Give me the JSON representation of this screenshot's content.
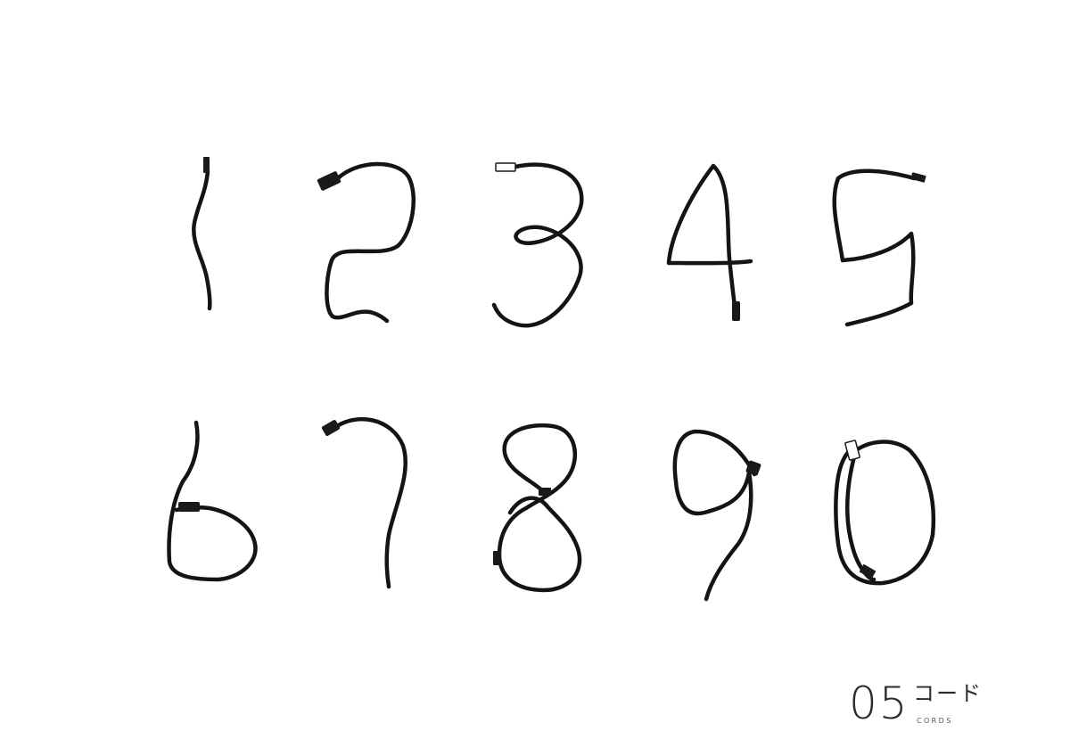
{
  "caption": {
    "number": "05",
    "title": "コード",
    "subtitle": "CORDS"
  },
  "digits": [
    "1",
    "2",
    "3",
    "4",
    "5",
    "6",
    "7",
    "8",
    "9",
    "0"
  ],
  "colors": {
    "background": "#ffffff",
    "cord": "#141414",
    "caption_text": "#2b2b2b"
  }
}
